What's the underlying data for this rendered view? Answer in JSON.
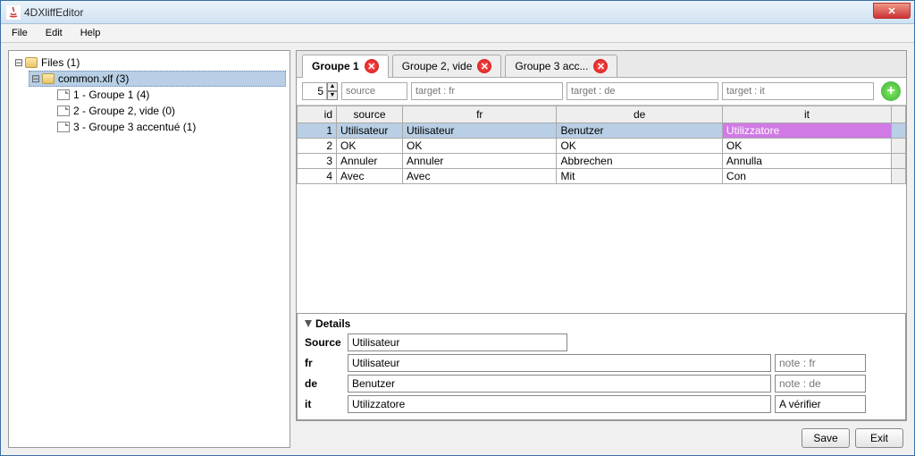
{
  "window": {
    "title": "4DXliffEditor"
  },
  "menubar": {
    "file": "File",
    "edit": "Edit",
    "help": "Help"
  },
  "tree": {
    "root": "Files (1)",
    "file": "common.xlf (3)",
    "nodes": [
      "1 - Groupe 1 (4)",
      "2 - Groupe 2, vide (0)",
      "3 - Groupe 3 accentué (1)"
    ]
  },
  "tabs": [
    {
      "label": "Groupe 1",
      "active": true
    },
    {
      "label": "Groupe 2, vide",
      "active": false
    },
    {
      "label": "Groupe 3 acc...",
      "active": false
    }
  ],
  "filter": {
    "count": "5",
    "placeholders": {
      "source": "source",
      "fr": "target : fr",
      "de": "target : de",
      "it": "target : it"
    }
  },
  "table": {
    "headers": {
      "id": "id",
      "source": "source",
      "fr": "fr",
      "de": "de",
      "it": "it"
    },
    "rows": [
      {
        "id": "1",
        "source": "Utilisateur",
        "fr": "Utilisateur",
        "de": "Benutzer",
        "it": "Utilizzatore",
        "selected": true
      },
      {
        "id": "2",
        "source": "OK",
        "fr": "OK",
        "de": "OK",
        "it": "OK"
      },
      {
        "id": "3",
        "source": "Annuler",
        "fr": "Annuler",
        "de": "Abbrechen",
        "it": "Annulla"
      },
      {
        "id": "4",
        "source": "Avec",
        "fr": "Avec",
        "de": "Mit",
        "it": "Con"
      }
    ]
  },
  "details": {
    "title": "Details",
    "source_label": "Source",
    "source": "Utilisateur",
    "fr_label": "fr",
    "fr": "Utilisateur",
    "fr_note_ph": "note : fr",
    "de_label": "de",
    "de": "Benutzer",
    "de_note_ph": "note : de",
    "it_label": "it",
    "it": "Utilizzatore",
    "it_note": "A vérifier"
  },
  "buttons": {
    "save": "Save",
    "exit": "Exit"
  }
}
